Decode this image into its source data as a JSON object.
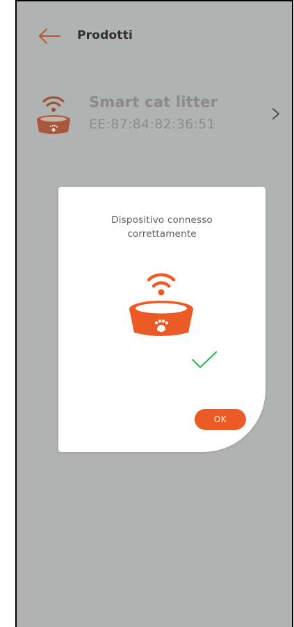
{
  "header": {
    "back_icon": "arrow-left-icon",
    "title": "Prodotti"
  },
  "product": {
    "icon": "smart-bowl-wifi-icon",
    "name": "Smart cat litter",
    "mac": "EE:87:84:82:36:51",
    "chevron_icon": "chevron-right-icon"
  },
  "dialog": {
    "message_line1": "Dispositivo connesso",
    "message_line2": "correttamente",
    "icon": "smart-bowl-wifi-icon",
    "status_icon": "checkmark-icon",
    "ok_label": "OK"
  },
  "colors": {
    "accent": "#ec5a26",
    "overlay_background": "#b0b3b2",
    "success": "#2fb44a",
    "dialog_background": "#ffffff"
  }
}
